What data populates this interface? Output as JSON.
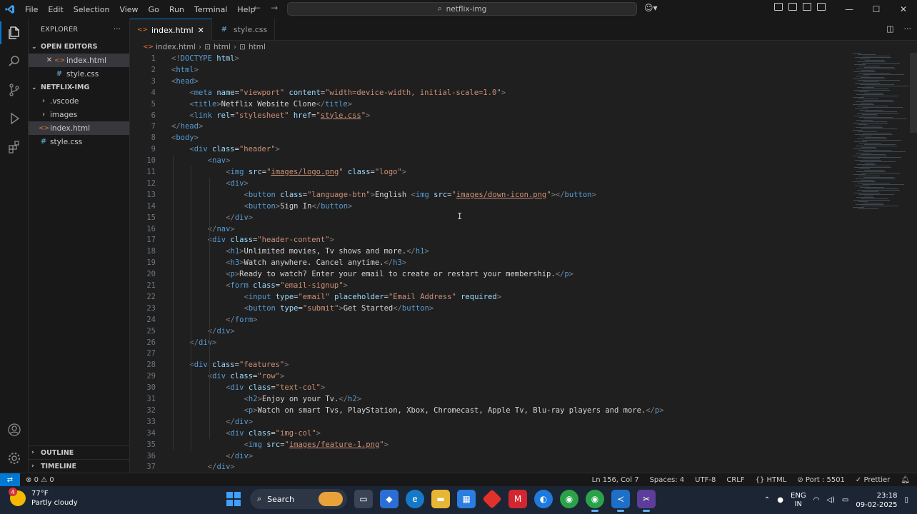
{
  "window": {
    "menu": [
      "File",
      "Edit",
      "Selection",
      "View",
      "Go",
      "Run",
      "Terminal",
      "Help"
    ],
    "search_text": "netflix-img"
  },
  "explorer": {
    "title": "EXPLORER",
    "open_editors_label": "OPEN EDITORS",
    "open_editors": [
      {
        "name": "index.html",
        "type": "html"
      },
      {
        "name": "style.css",
        "type": "css"
      }
    ],
    "folder_label": "NETFLIX-IMG",
    "tree": [
      {
        "name": ".vscode",
        "type": "folder"
      },
      {
        "name": "images",
        "type": "folder"
      },
      {
        "name": "index.html",
        "type": "html"
      },
      {
        "name": "style.css",
        "type": "css"
      }
    ],
    "outline_label": "OUTLINE",
    "timeline_label": "TIMELINE"
  },
  "tabs": [
    {
      "label": "index.html",
      "type": "html",
      "active": true
    },
    {
      "label": "style.css",
      "type": "css",
      "active": false
    }
  ],
  "breadcrumb": [
    "index.html",
    "html",
    "html"
  ],
  "code_lines": [
    {
      "n": "1",
      "indent": 0,
      "tokens": [
        [
          "br",
          "<!"
        ],
        [
          "tag",
          "DOCTYPE"
        ],
        [
          "text",
          " "
        ],
        [
          "attr",
          "html"
        ],
        [
          "br",
          ">"
        ]
      ]
    },
    {
      "n": "2",
      "indent": 0,
      "tokens": [
        [
          "br",
          "<"
        ],
        [
          "tag",
          "html"
        ],
        [
          "br",
          ">"
        ]
      ]
    },
    {
      "n": "3",
      "indent": 0,
      "tokens": [
        [
          "br",
          "<"
        ],
        [
          "tag",
          "head"
        ],
        [
          "br",
          ">"
        ]
      ]
    },
    {
      "n": "4",
      "indent": 1,
      "tokens": [
        [
          "br",
          "<"
        ],
        [
          "tag",
          "meta"
        ],
        [
          "text",
          " "
        ],
        [
          "attr",
          "name"
        ],
        [
          "text",
          "="
        ],
        [
          "str",
          "\"viewport\""
        ],
        [
          "text",
          " "
        ],
        [
          "attr",
          "content"
        ],
        [
          "text",
          "="
        ],
        [
          "str",
          "\"width=device-width, initial-scale=1.0\""
        ],
        [
          "br",
          ">"
        ]
      ]
    },
    {
      "n": "5",
      "indent": 1,
      "tokens": [
        [
          "br",
          "<"
        ],
        [
          "tag",
          "title"
        ],
        [
          "br",
          ">"
        ],
        [
          "text",
          "Netflix Website Clone"
        ],
        [
          "br",
          "</"
        ],
        [
          "tag",
          "title"
        ],
        [
          "br",
          ">"
        ]
      ]
    },
    {
      "n": "6",
      "indent": 1,
      "tokens": [
        [
          "br",
          "<"
        ],
        [
          "tag",
          "link"
        ],
        [
          "text",
          " "
        ],
        [
          "attr",
          "rel"
        ],
        [
          "text",
          "="
        ],
        [
          "str",
          "\"stylesheet\""
        ],
        [
          "text",
          " "
        ],
        [
          "attr",
          "href"
        ],
        [
          "text",
          "="
        ],
        [
          "str",
          "\""
        ],
        [
          "link",
          "style.css"
        ],
        [
          "str",
          "\""
        ],
        [
          "br",
          ">"
        ]
      ]
    },
    {
      "n": "7",
      "indent": 0,
      "tokens": [
        [
          "br",
          "</"
        ],
        [
          "tag",
          "head"
        ],
        [
          "br",
          ">"
        ]
      ]
    },
    {
      "n": "8",
      "indent": 0,
      "tokens": [
        [
          "br",
          "<"
        ],
        [
          "tag",
          "body"
        ],
        [
          "br",
          ">"
        ]
      ]
    },
    {
      "n": "9",
      "indent": 1,
      "tokens": [
        [
          "br",
          "<"
        ],
        [
          "tag",
          "div"
        ],
        [
          "text",
          " "
        ],
        [
          "attr",
          "class"
        ],
        [
          "text",
          "="
        ],
        [
          "str",
          "\"header\""
        ],
        [
          "br",
          ">"
        ]
      ]
    },
    {
      "n": "10",
      "indent": 2,
      "tokens": [
        [
          "br",
          "<"
        ],
        [
          "tag",
          "nav"
        ],
        [
          "br",
          ">"
        ]
      ]
    },
    {
      "n": "11",
      "indent": 3,
      "tokens": [
        [
          "br",
          "<"
        ],
        [
          "tag",
          "img"
        ],
        [
          "text",
          " "
        ],
        [
          "attr",
          "src"
        ],
        [
          "text",
          "="
        ],
        [
          "str",
          "\""
        ],
        [
          "link",
          "images/logo.png"
        ],
        [
          "str",
          "\""
        ],
        [
          "text",
          " "
        ],
        [
          "attr",
          "class"
        ],
        [
          "text",
          "="
        ],
        [
          "str",
          "\"logo\""
        ],
        [
          "br",
          ">"
        ]
      ]
    },
    {
      "n": "12",
      "indent": 3,
      "tokens": [
        [
          "br",
          "<"
        ],
        [
          "tag",
          "div"
        ],
        [
          "br",
          ">"
        ]
      ]
    },
    {
      "n": "13",
      "indent": 4,
      "tokens": [
        [
          "br",
          "<"
        ],
        [
          "tag",
          "button"
        ],
        [
          "text",
          " "
        ],
        [
          "attr",
          "class"
        ],
        [
          "text",
          "="
        ],
        [
          "str",
          "\"language-btn\""
        ],
        [
          "br",
          ">"
        ],
        [
          "text",
          "English "
        ],
        [
          "br",
          "<"
        ],
        [
          "tag",
          "img"
        ],
        [
          "text",
          " "
        ],
        [
          "attr",
          "src"
        ],
        [
          "text",
          "="
        ],
        [
          "str",
          "\""
        ],
        [
          "link",
          "images/down-icon.png"
        ],
        [
          "str",
          "\""
        ],
        [
          "br",
          "></"
        ],
        [
          "tag",
          "button"
        ],
        [
          "br",
          ">"
        ]
      ]
    },
    {
      "n": "14",
      "indent": 4,
      "tokens": [
        [
          "br",
          "<"
        ],
        [
          "tag",
          "button"
        ],
        [
          "br",
          ">"
        ],
        [
          "text",
          "Sign In"
        ],
        [
          "br",
          "</"
        ],
        [
          "tag",
          "button"
        ],
        [
          "br",
          ">"
        ]
      ]
    },
    {
      "n": "15",
      "indent": 3,
      "tokens": [
        [
          "br",
          "</"
        ],
        [
          "tag",
          "div"
        ],
        [
          "br",
          ">"
        ]
      ]
    },
    {
      "n": "16",
      "indent": 2,
      "tokens": [
        [
          "br",
          "</"
        ],
        [
          "tag",
          "nav"
        ],
        [
          "br",
          ">"
        ]
      ]
    },
    {
      "n": "17",
      "indent": 2,
      "tokens": [
        [
          "br",
          "<"
        ],
        [
          "tag",
          "div"
        ],
        [
          "text",
          " "
        ],
        [
          "attr",
          "class"
        ],
        [
          "text",
          "="
        ],
        [
          "str",
          "\"header-content\""
        ],
        [
          "br",
          ">"
        ]
      ]
    },
    {
      "n": "18",
      "indent": 3,
      "tokens": [
        [
          "br",
          "<"
        ],
        [
          "tag",
          "h1"
        ],
        [
          "br",
          ">"
        ],
        [
          "text",
          "Unlimited movies, Tv shows and more."
        ],
        [
          "br",
          "</"
        ],
        [
          "tag",
          "h1"
        ],
        [
          "br",
          ">"
        ]
      ]
    },
    {
      "n": "19",
      "indent": 3,
      "tokens": [
        [
          "br",
          "<"
        ],
        [
          "tag",
          "h3"
        ],
        [
          "br",
          ">"
        ],
        [
          "text",
          "Watch anywhere. Cancel anytime."
        ],
        [
          "br",
          "</"
        ],
        [
          "tag",
          "h3"
        ],
        [
          "br",
          ">"
        ]
      ]
    },
    {
      "n": "20",
      "indent": 3,
      "tokens": [
        [
          "br",
          "<"
        ],
        [
          "tag",
          "p"
        ],
        [
          "br",
          ">"
        ],
        [
          "text",
          "Ready to watch? Enter your email to create or restart your membership."
        ],
        [
          "br",
          "</"
        ],
        [
          "tag",
          "p"
        ],
        [
          "br",
          ">"
        ]
      ]
    },
    {
      "n": "21",
      "indent": 3,
      "tokens": [
        [
          "br",
          "<"
        ],
        [
          "tag",
          "form"
        ],
        [
          "text",
          " "
        ],
        [
          "attr",
          "class"
        ],
        [
          "text",
          "="
        ],
        [
          "str",
          "\"email-signup\""
        ],
        [
          "br",
          ">"
        ]
      ]
    },
    {
      "n": "22",
      "indent": 4,
      "tokens": [
        [
          "br",
          "<"
        ],
        [
          "tag",
          "input"
        ],
        [
          "text",
          " "
        ],
        [
          "attr",
          "type"
        ],
        [
          "text",
          "="
        ],
        [
          "str",
          "\"email\""
        ],
        [
          "text",
          " "
        ],
        [
          "attr",
          "placeholder"
        ],
        [
          "text",
          "="
        ],
        [
          "str",
          "\"Email Address\""
        ],
        [
          "text",
          " "
        ],
        [
          "attr",
          "required"
        ],
        [
          "br",
          ">"
        ]
      ]
    },
    {
      "n": "23",
      "indent": 4,
      "tokens": [
        [
          "br",
          "<"
        ],
        [
          "tag",
          "button"
        ],
        [
          "text",
          " "
        ],
        [
          "attr",
          "type"
        ],
        [
          "text",
          "="
        ],
        [
          "str",
          "\"submit\""
        ],
        [
          "br",
          ">"
        ],
        [
          "text",
          "Get Started"
        ],
        [
          "br",
          "</"
        ],
        [
          "tag",
          "button"
        ],
        [
          "br",
          ">"
        ]
      ]
    },
    {
      "n": "24",
      "indent": 3,
      "tokens": [
        [
          "br",
          "</"
        ],
        [
          "tag",
          "form"
        ],
        [
          "br",
          ">"
        ]
      ]
    },
    {
      "n": "25",
      "indent": 2,
      "tokens": [
        [
          "br",
          "</"
        ],
        [
          "tag",
          "div"
        ],
        [
          "br",
          ">"
        ]
      ]
    },
    {
      "n": "26",
      "indent": 1,
      "tokens": [
        [
          "br",
          "</"
        ],
        [
          "tag",
          "div"
        ],
        [
          "br",
          ">"
        ]
      ]
    },
    {
      "n": "27",
      "indent": 0,
      "tokens": []
    },
    {
      "n": "28",
      "indent": 1,
      "tokens": [
        [
          "br",
          "<"
        ],
        [
          "tag",
          "div"
        ],
        [
          "text",
          " "
        ],
        [
          "attr",
          "class"
        ],
        [
          "text",
          "="
        ],
        [
          "str",
          "\"features\""
        ],
        [
          "br",
          ">"
        ]
      ]
    },
    {
      "n": "29",
      "indent": 2,
      "tokens": [
        [
          "br",
          "<"
        ],
        [
          "tag",
          "div"
        ],
        [
          "text",
          " "
        ],
        [
          "attr",
          "class"
        ],
        [
          "text",
          "="
        ],
        [
          "str",
          "\"row\""
        ],
        [
          "br",
          ">"
        ]
      ]
    },
    {
      "n": "30",
      "indent": 3,
      "tokens": [
        [
          "br",
          "<"
        ],
        [
          "tag",
          "div"
        ],
        [
          "text",
          " "
        ],
        [
          "attr",
          "class"
        ],
        [
          "text",
          "="
        ],
        [
          "str",
          "\"text-col\""
        ],
        [
          "br",
          ">"
        ]
      ]
    },
    {
      "n": "31",
      "indent": 4,
      "tokens": [
        [
          "br",
          "<"
        ],
        [
          "tag",
          "h2"
        ],
        [
          "br",
          ">"
        ],
        [
          "text",
          "Enjoy on your Tv."
        ],
        [
          "br",
          "</"
        ],
        [
          "tag",
          "h2"
        ],
        [
          "br",
          ">"
        ]
      ]
    },
    {
      "n": "32",
      "indent": 4,
      "tokens": [
        [
          "br",
          "<"
        ],
        [
          "tag",
          "p"
        ],
        [
          "br",
          ">"
        ],
        [
          "text",
          "Watch on smart Tvs, PlayStation, Xbox, Chromecast, Apple Tv, Blu-ray players and more."
        ],
        [
          "br",
          "</"
        ],
        [
          "tag",
          "p"
        ],
        [
          "br",
          ">"
        ]
      ]
    },
    {
      "n": "33",
      "indent": 3,
      "tokens": [
        [
          "br",
          "</"
        ],
        [
          "tag",
          "div"
        ],
        [
          "br",
          ">"
        ]
      ]
    },
    {
      "n": "34",
      "indent": 3,
      "tokens": [
        [
          "br",
          "<"
        ],
        [
          "tag",
          "div"
        ],
        [
          "text",
          " "
        ],
        [
          "attr",
          "class"
        ],
        [
          "text",
          "="
        ],
        [
          "str",
          "\"img-col\""
        ],
        [
          "br",
          ">"
        ]
      ]
    },
    {
      "n": "35",
      "indent": 4,
      "tokens": [
        [
          "br",
          "<"
        ],
        [
          "tag",
          "img"
        ],
        [
          "text",
          " "
        ],
        [
          "attr",
          "src"
        ],
        [
          "text",
          "="
        ],
        [
          "str",
          "\""
        ],
        [
          "link",
          "images/feature-1.png"
        ],
        [
          "str",
          "\""
        ],
        [
          "br",
          ">"
        ]
      ]
    },
    {
      "n": "36",
      "indent": 3,
      "tokens": [
        [
          "br",
          "</"
        ],
        [
          "tag",
          "div"
        ],
        [
          "br",
          ">"
        ]
      ]
    },
    {
      "n": "37",
      "indent": 2,
      "tokens": [
        [
          "br",
          "</"
        ],
        [
          "tag",
          "div"
        ],
        [
          "br",
          ">"
        ]
      ]
    }
  ],
  "statusbar": {
    "errors": "0",
    "warnings": "0",
    "position": "Ln 156, Col 7",
    "spaces": "Spaces: 4",
    "encoding": "UTF-8",
    "eol": "CRLF",
    "language": "HTML",
    "port": "Port : 5501",
    "formatter": "Prettier"
  },
  "taskbar": {
    "temperature": "77°F",
    "weather": "Partly cloudy",
    "weather_badge": "4",
    "search_label": "Search",
    "lang_line1": "ENG",
    "lang_line2": "IN",
    "time": "23:18",
    "date": "09-02-2025"
  },
  "colors": {
    "accent": "#0078d4",
    "html_icon": "#e37933",
    "css_icon": "#519aba"
  }
}
